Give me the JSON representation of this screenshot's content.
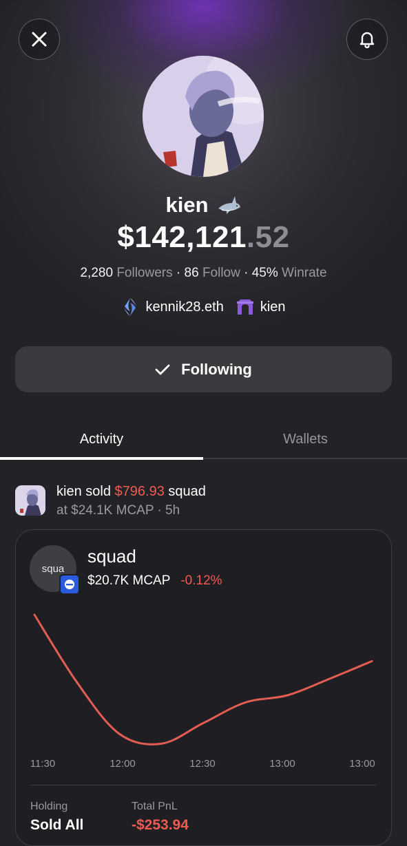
{
  "header": {
    "close_icon": "close-icon",
    "bell_icon": "bell-icon"
  },
  "profile": {
    "name": "kien",
    "badge_icon": "shark-icon",
    "balance_main": "$142,121",
    "balance_cents": ".52",
    "followers_count": "2,280",
    "followers_label": "Followers",
    "follow_count": "86",
    "follow_label": "Follow",
    "winrate_value": "45%",
    "winrate_label": "Winrate",
    "separator": "·",
    "ens_name": "kennik28.eth",
    "alt_name": "kien"
  },
  "follow_button": {
    "label": "Following"
  },
  "tabs": [
    {
      "label": "Activity",
      "active": true
    },
    {
      "label": "Wallets",
      "active": false
    }
  ],
  "activity": {
    "user": "kien",
    "action": "sold",
    "amount": "$796.93",
    "token": "squad",
    "detail": "at $24.1K MCAP · 5h"
  },
  "token_card": {
    "logo_text": "squa",
    "name": "squad",
    "mcap": "$20.7K MCAP",
    "change": "-0.12%",
    "holding_label": "Holding",
    "holding_value": "Sold All",
    "pnl_label": "Total PnL",
    "pnl_value": "-$253.94"
  },
  "chart_data": {
    "type": "line",
    "x": [
      "11:30",
      "11:45",
      "12:00",
      "12:15",
      "12:30",
      "12:45",
      "13:00",
      "13:15",
      "13:30"
    ],
    "tick_labels": [
      "11:30",
      "12:00",
      "12:30",
      "13:00",
      "13:00"
    ],
    "series": [
      {
        "values": [
          20.9,
          20.25,
          19.75,
          19.65,
          19.85,
          20.05,
          20.12,
          20.28,
          20.45
        ]
      }
    ],
    "ylim": [
      19.6,
      21.0
    ],
    "grid": false,
    "color": "#e35d53"
  },
  "colors": {
    "accent_negative": "#ef5b52",
    "background": "#232327",
    "button": "#3a3a3f"
  }
}
